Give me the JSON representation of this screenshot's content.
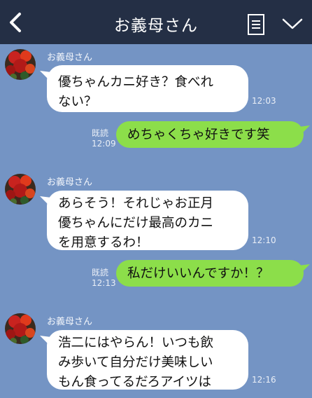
{
  "header": {
    "title": "お義母さん",
    "back_icon": "chevron-left-icon",
    "menu_icon": "list-icon",
    "collapse_icon": "chevron-down-icon"
  },
  "messages": [
    {
      "side": "in",
      "sender": "お義母さん",
      "lines": [
        "優ちゃんカニ好き？食べれ",
        "ない？"
      ],
      "time": "12:03"
    },
    {
      "side": "out",
      "read": "既読",
      "time": "12:09",
      "text": "めちゃくちゃ好きです笑"
    },
    {
      "side": "in",
      "sender": "お義母さん",
      "lines": [
        "あらそう！それじゃお正月",
        "優ちゃんにだけ最高のカニ",
        "を用意するわ！"
      ],
      "time": "12:10"
    },
    {
      "side": "out",
      "read": "既読",
      "time": "12:13",
      "text": "私だけいいんですか！？"
    },
    {
      "side": "in",
      "sender": "お義母さん",
      "lines": [
        "浩二にはやらん！いつも飲",
        "み歩いて自分だけ美味しい",
        "もん食ってるだろアイツは"
      ],
      "time": "12:16"
    }
  ],
  "colors": {
    "background": "#7494c4",
    "header": "#242f45",
    "outgoing_bubble": "#8cde4a",
    "incoming_bubble": "#ffffff"
  }
}
